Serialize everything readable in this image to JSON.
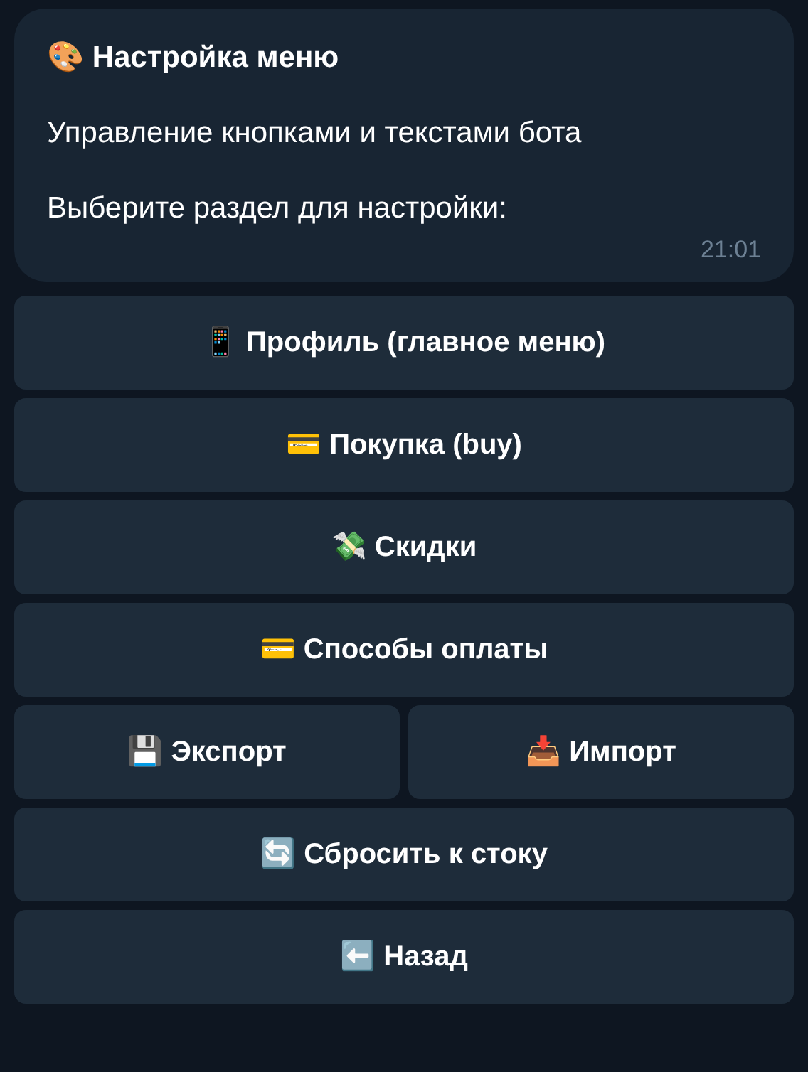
{
  "message": {
    "title": "🎨 Настройка меню",
    "paragraphs": [
      "Управление кнопками и текстами бота",
      "Выберите раздел для настройки:"
    ],
    "time": "21:01"
  },
  "keyboard": [
    [
      "📱 Профиль (главное меню)"
    ],
    [
      "💳 Покупка (buy)"
    ],
    [
      "💸 Скидки"
    ],
    [
      "💳 Способы оплаты"
    ],
    [
      "💾 Экспорт",
      "📥 Импорт"
    ],
    [
      "🔄 Сбросить к стоку"
    ],
    [
      "⬅️ Назад"
    ]
  ]
}
